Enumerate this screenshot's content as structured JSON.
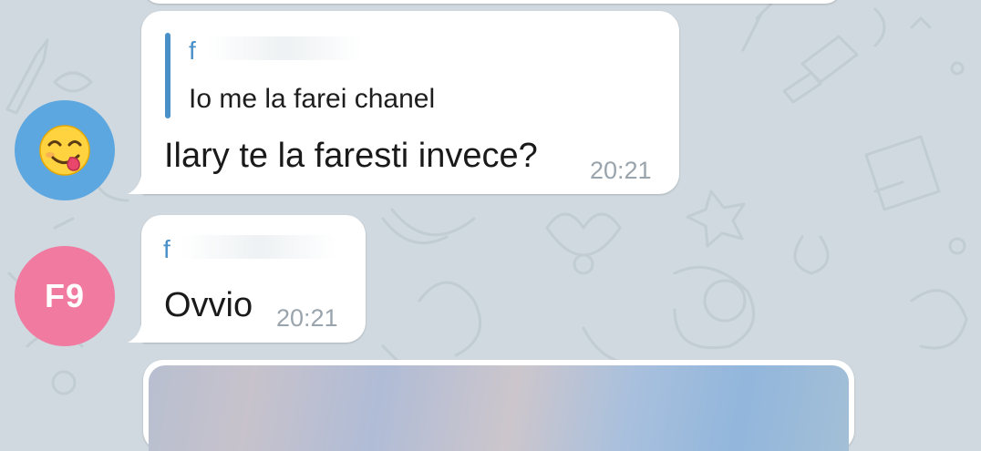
{
  "chat": {
    "messages": [
      {
        "sender_initials": "",
        "avatar_icon": "face-savoring-food-emoji",
        "reply_to": {
          "sender": "f",
          "text": "Io me la farei chanel"
        },
        "text": "Ilary te la faresti invece?",
        "time": "20:21"
      },
      {
        "sender_initials": "F9",
        "reply_to": {
          "sender": "f"
        },
        "text": "Ovvio",
        "time": "20:21"
      }
    ]
  },
  "colors": {
    "background": "#cfd9df",
    "reply_accent": "#4a90c8",
    "avatar_blue": "#5da7e0",
    "avatar_pink": "#f07aa0",
    "time_text": "#9aa4ad"
  }
}
